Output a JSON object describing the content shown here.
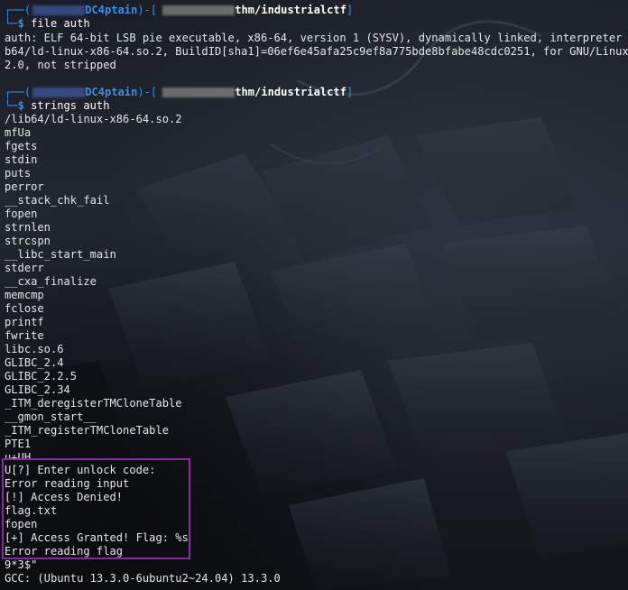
{
  "prompt1": {
    "host": "DC4ptain",
    "dir": "thm/industrialctf",
    "command": "file auth"
  },
  "file_output": [
    "auth: ELF 64-bit LSB pie executable, x86-64, version 1 (SYSV), dynamically linked, interpreter /li",
    "b64/ld-linux-x86-64.so.2, BuildID[sha1]=06ef6e45afa25c9ef8a775bde8bfabe48cdc0251, for GNU/Linux 3.",
    "2.0, not stripped"
  ],
  "prompt2": {
    "host": "DC4ptain",
    "dir": "thm/industrialctf",
    "command": "strings auth"
  },
  "strings_output": [
    "/lib64/ld-linux-x86-64.so.2",
    "mfUa",
    "fgets",
    "stdin",
    "puts",
    "perror",
    "__stack_chk_fail",
    "fopen",
    "strnlen",
    "strcspn",
    "__libc_start_main",
    "stderr",
    "__cxa_finalize",
    "memcmp",
    "fclose",
    "printf",
    "fwrite",
    "libc.so.6",
    "GLIBC_2.4",
    "GLIBC_2.2.5",
    "GLIBC_2.34",
    "_ITM_deregisterTMCloneTable",
    "__gmon_start__",
    "_ITM_registerTMCloneTable",
    "PTE1",
    "u+UH",
    "U[?] Enter unlock code:",
    "Error reading input",
    "[!] Access Denied!",
    "flag.txt",
    "fopen",
    "[+] Access Granted! Flag: %s",
    "Error reading flag",
    "9*3$\"",
    "GCC: (Ubuntu 13.3.0-6ubuntu2~24.04) 13.3.0"
  ],
  "colors": {
    "prompt": "#3b8eea",
    "highlight": "#8a2aa2",
    "text": "#e6e6e6"
  }
}
